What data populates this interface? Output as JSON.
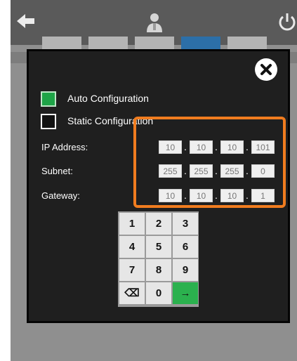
{
  "colors": {
    "accent_orange": "#f07c1f",
    "check_green": "#1ea447",
    "enter_green": "#2bb14e",
    "tab_active_blue": "#2c6fa8"
  },
  "topbar": {
    "back_icon": "arrow-left-icon",
    "user_icon": "user-icon",
    "power_icon": "power-icon"
  },
  "dialog": {
    "close_icon": "close-icon",
    "auto_config": {
      "label": "Auto Configuration",
      "checked": true
    },
    "static_config": {
      "label": "Static Configuration",
      "checked": false
    },
    "fields": [
      {
        "label": "IP Address:",
        "octets": [
          "10",
          "10",
          "10",
          "101"
        ]
      },
      {
        "label": "Subnet:",
        "octets": [
          "255",
          "255",
          "255",
          "0"
        ]
      },
      {
        "label": "Gateway:",
        "octets": [
          "10",
          "10",
          "10",
          "1"
        ]
      }
    ],
    "keypad": {
      "keys": [
        "1",
        "2",
        "3",
        "4",
        "5",
        "6",
        "7",
        "8",
        "9",
        "⌫",
        "0",
        "→"
      ]
    }
  }
}
